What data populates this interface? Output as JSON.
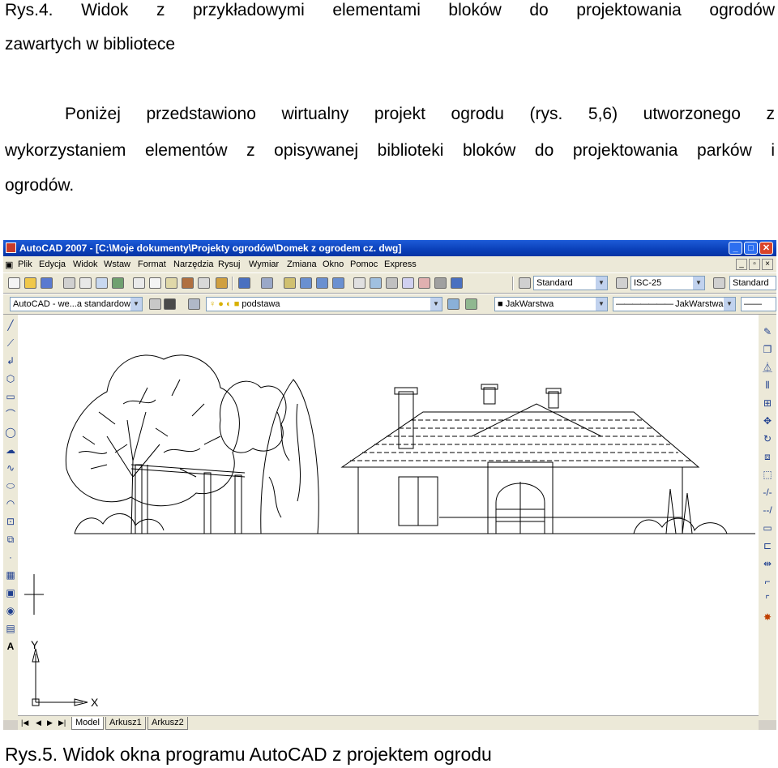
{
  "doc": {
    "fig4_caption_line1": "Rys.4.  Widok  z  przykładowymi  elementami  bloków  do  projektowania  ogrodów",
    "fig4_caption_line2": "zawartych w bibliotece",
    "para_line1": "Poniżej  przedstawiono  wirtualny  projekt  ogrodu  (rys.  5,6)  utworzonego  z",
    "para_line2": "wykorzystaniem elementów z opisywanej biblioteki bloków do projektowania parków i",
    "para_line3": "ogrodów.",
    "fig5_caption": "Rys.5. Widok okna programu AutoCAD z projektem ogrodu"
  },
  "app": {
    "title": "AutoCAD 2007 - [C:\\Moje dokumenty\\Projekty ogrodów\\Domek z ogrodem cz. dwg]",
    "title_color": "#0a3fb8",
    "menus": [
      "Plik",
      "Edycja",
      "Widok",
      "Wstaw",
      "Format",
      "Narzędzia",
      "Rysuj",
      "Wymiar",
      "Zmiana",
      "Okno",
      "Pomoc",
      "Express"
    ],
    "toolbar": {
      "text_style": "Standard",
      "dim_style": "ISC-25",
      "table_style": "Standard",
      "workspace": "AutoCAD - we...a standardowe",
      "layer": "podstawa",
      "color": "JakWarstwa",
      "linetype": "JakWarstwa"
    },
    "tabs": [
      "Model",
      "Arkusz1",
      "Arkusz2"
    ],
    "active_tab": "Model",
    "ucs": {
      "x_label": "X",
      "y_label": "Y"
    },
    "left_tools": [
      "line-icon",
      "construction-line-icon",
      "polyline-icon",
      "polygon-icon",
      "rectangle-icon",
      "arc-icon",
      "circle-icon",
      "revision-cloud-icon",
      "spline-icon",
      "ellipse-icon",
      "ellipse-arc-icon",
      "insert-block-icon",
      "make-block-icon",
      "point-icon",
      "hatch-icon",
      "gradient-icon",
      "region-icon",
      "table-icon",
      "mtext-icon"
    ],
    "right_tools": [
      "erase-icon",
      "copy-icon",
      "mirror-icon",
      "offset-icon",
      "array-icon",
      "move-icon",
      "rotate-icon",
      "scale-icon",
      "stretch-icon",
      "trim-icon",
      "extend-icon",
      "break-at-point-icon",
      "break-icon",
      "join-icon",
      "chamfer-icon",
      "fillet-icon",
      "explode-icon"
    ]
  }
}
